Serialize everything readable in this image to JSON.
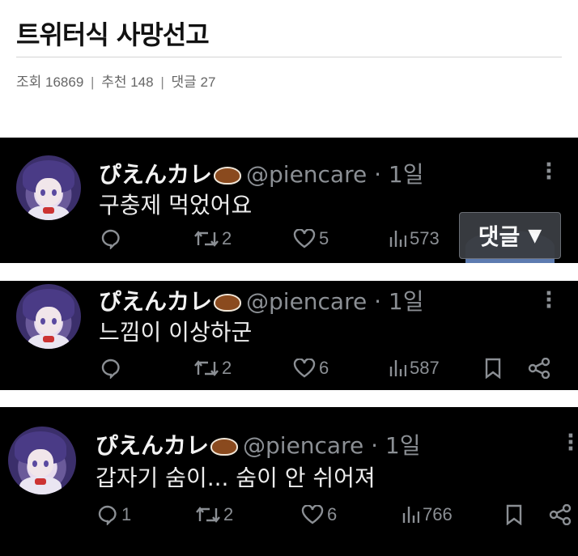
{
  "post": {
    "title": "트위터식 사망선고",
    "views_label": "조회",
    "views": "16869",
    "recommend_label": "추천",
    "recommend": "148",
    "comments_label": "댓글",
    "comments": "27",
    "separator": "|"
  },
  "comment_button": {
    "label": "댓글",
    "arrow": "▼"
  },
  "tweets": [
    {
      "display_name": "ぴえんカレ",
      "handle": "@piencare · 1일",
      "text": "구충제 먹었어요",
      "replies": "",
      "retweets": "2",
      "likes": "5",
      "views": "573"
    },
    {
      "display_name": "ぴえんカレ",
      "handle": "@piencare · 1일",
      "text": "느낌이 이상하군",
      "replies": "",
      "retweets": "2",
      "likes": "6",
      "views": "587"
    },
    {
      "display_name": "ぴえんカレ",
      "handle": "@piencare · 1일",
      "text": "갑자기 숨이... 숨이 안 쉬어져",
      "replies": "1",
      "retweets": "2",
      "likes": "6",
      "views": "766"
    }
  ],
  "icons": {
    "reply": "reply-icon",
    "retweet": "retweet-icon",
    "like": "heart-icon",
    "views": "views-icon",
    "bookmark": "bookmark-icon",
    "share": "share-icon",
    "more": "more-icon",
    "curry_emoji": "curry-emoji-icon"
  },
  "colors": {
    "tweet_bg": "#000000",
    "muted": "#8b8f94",
    "text": "#ececec"
  }
}
